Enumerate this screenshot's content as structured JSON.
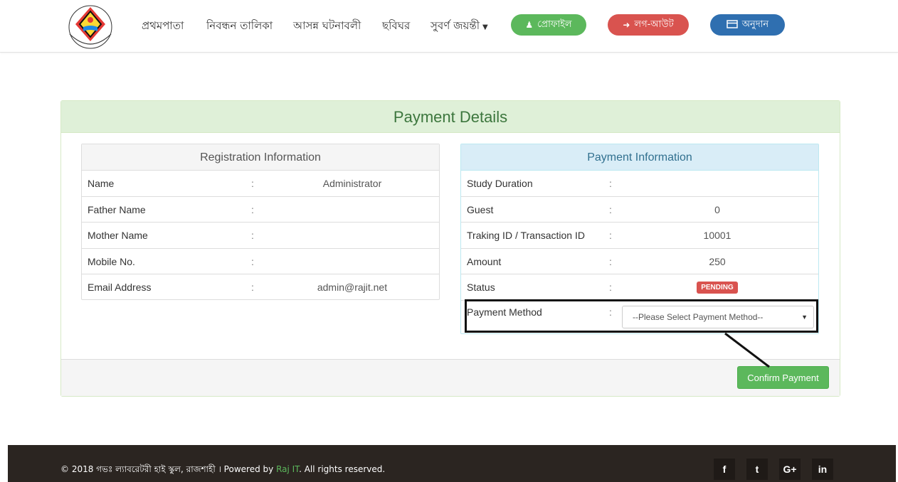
{
  "nav": {
    "links": [
      "প্রথমপাতা",
      "নিবন্ধন তালিকা",
      "আসন্ন ঘটনাবলী",
      "ছবিঘর",
      "সুবর্ণ জয়ন্তী"
    ],
    "profile_label": "প্রোফাইল",
    "logout_label": "লগ-আউট",
    "donate_label": "অনুদান"
  },
  "panel": {
    "title": "Payment Details",
    "confirm_label": "Confirm Payment"
  },
  "registration": {
    "heading": "Registration Information",
    "rows": [
      {
        "label": "Name",
        "value": "Administrator"
      },
      {
        "label": "Father Name",
        "value": ""
      },
      {
        "label": "Mother Name",
        "value": ""
      },
      {
        "label": "Mobile No.",
        "value": ""
      },
      {
        "label": "Email Address",
        "value": "admin@rajit.net"
      }
    ]
  },
  "payment": {
    "heading": "Payment Information",
    "rows": [
      {
        "label": "Study Duration",
        "value": ""
      },
      {
        "label": "Guest",
        "value": "0"
      },
      {
        "label": "Traking ID / Transaction ID",
        "value": "10001"
      },
      {
        "label": "Amount",
        "value": "250"
      },
      {
        "label": "Status",
        "value": "PENDING"
      }
    ],
    "method_label": "Payment Method",
    "method_selected": "--Please Select Payment Method--"
  },
  "footer": {
    "copyright_prefix": "© 2018 গভঃ ল্যাবরেটরী হাই স্কুল, রাজশাহী । Powered by ",
    "brand": "Raj IT",
    "copyright_suffix": ". All rights reserved.",
    "social": [
      "f",
      "t",
      "G+",
      "in"
    ]
  },
  "colors": {
    "accent_green": "#5cb85c",
    "danger_red": "#d9534f",
    "primary_blue": "#2f6fb0",
    "footer_bg": "#2b2521"
  }
}
